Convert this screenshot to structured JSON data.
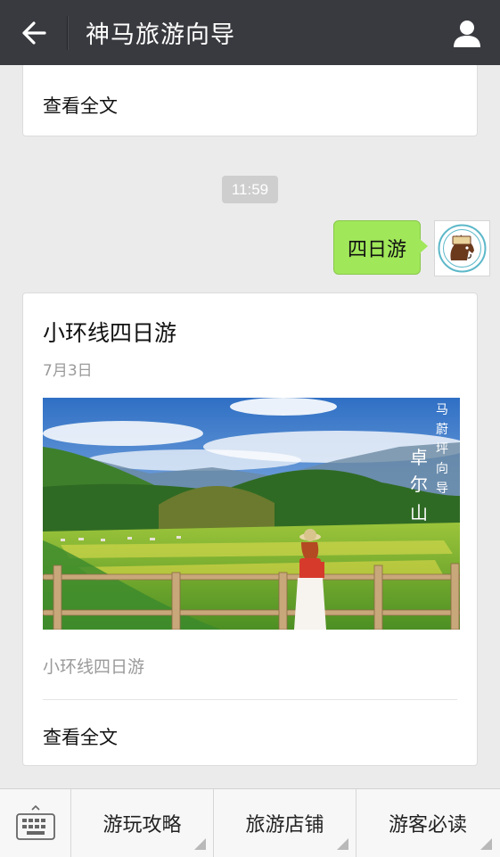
{
  "header": {
    "title": "神马旅游向导",
    "back_icon": "back-arrow-icon",
    "profile_icon": "person-icon"
  },
  "feed": {
    "prev_card": {
      "read_full": "查看全文"
    },
    "timestamp": "11:59",
    "user_message": "四日游",
    "article": {
      "title": "小环线四日游",
      "date": "7月3日",
      "cover_caption": [
        "马",
        "蔚",
        "坪",
        "向",
        "导",
        "卓",
        "尔",
        "山"
      ],
      "summary": "小环线四日游",
      "read_full": "查看全文"
    }
  },
  "bottom_menu": {
    "keyboard_icon": "keyboard-icon",
    "items": [
      {
        "label": "游玩攻略"
      },
      {
        "label": "旅游店铺"
      },
      {
        "label": "游客必读"
      }
    ]
  },
  "colors": {
    "topbar": "#393a3f",
    "bubble": "#a0e75a",
    "background": "#ebebeb"
  }
}
